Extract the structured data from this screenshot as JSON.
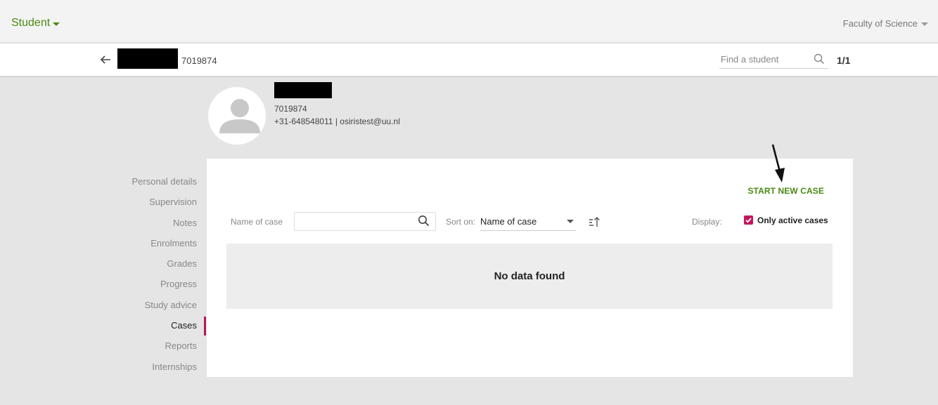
{
  "topbar": {
    "app_switch_label": "Student",
    "faculty_label": "Faculty of Science"
  },
  "student_bar": {
    "student_id": "7019874",
    "find_placeholder": "Find a student",
    "pager": "1/1"
  },
  "profile": {
    "student_id": "7019874",
    "contact": "+31-648548011 | osiristest@uu.nl"
  },
  "nav": {
    "items": [
      {
        "label": "Personal details"
      },
      {
        "label": "Supervision"
      },
      {
        "label": "Notes"
      },
      {
        "label": "Enrolments"
      },
      {
        "label": "Grades"
      },
      {
        "label": "Progress"
      },
      {
        "label": "Study advice"
      },
      {
        "label": "Cases",
        "active": true
      },
      {
        "label": "Reports"
      },
      {
        "label": "Internships"
      }
    ]
  },
  "cases": {
    "start_new_case_label": "START NEW CASE",
    "name_of_case_label": "Name of case",
    "name_of_case_value": "",
    "sort_on_label": "Sort on:",
    "sort_value": "Name of case",
    "display_label": "Display:",
    "only_active_label": "Only active cases",
    "only_active_checked": true,
    "empty_message": "No data found"
  },
  "colors": {
    "brand_green": "#4a8a12",
    "accent_magenta": "#c2185b",
    "page_bg": "#e5e5e5"
  }
}
